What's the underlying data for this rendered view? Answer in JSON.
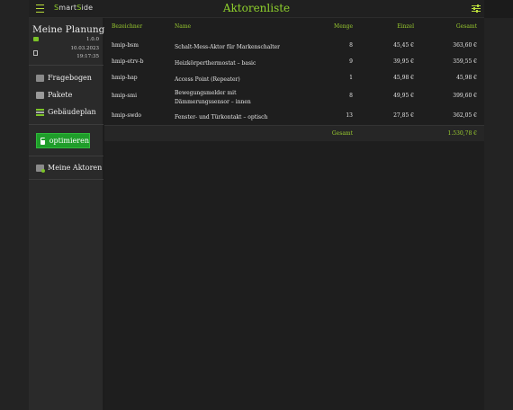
{
  "app": {
    "brand_prefix": "S",
    "brand_mid": "mart",
    "brand_accent": "S",
    "brand_suffix": "ide",
    "page_title": "Aktorenliste"
  },
  "project": {
    "title": "Meine Planung",
    "version": "1.0.0",
    "date": "10.03.2023",
    "time": "19:17:35"
  },
  "nav": {
    "fragebogen": "Fragebogen",
    "pakete": "Pakete",
    "gebaeudeplan": "Gebäudeplan",
    "optimieren": "optimieren",
    "meine_aktoren": "Meine Aktoren"
  },
  "table": {
    "headers": {
      "bezeichner": "Bezeichner",
      "name": "Name",
      "menge": "Menge",
      "einzel": "Einzel",
      "gesamt": "Gesamt"
    },
    "rows": [
      {
        "bezeichner": "hmip-bsm",
        "name": "Schalt-Mess-Aktor für Markenschalter",
        "name2": "",
        "menge": "8",
        "einzel": "45,45 €",
        "gesamt": "363,60 €"
      },
      {
        "bezeichner": "hmip-etrv-b",
        "name": "Heizkörperthermostat – basic",
        "name2": "",
        "menge": "9",
        "einzel": "39,95 €",
        "gesamt": "359,55 €"
      },
      {
        "bezeichner": "hmip-hap",
        "name": "Access Point (Repeater)",
        "name2": "",
        "menge": "1",
        "einzel": "45,98 €",
        "gesamt": "45,98 €"
      },
      {
        "bezeichner": "hmip-smi",
        "name": "Bewegungsmelder mit",
        "name2": "Dämmerungssensor – innen",
        "menge": "8",
        "einzel": "49,95 €",
        "gesamt": "399,60 €"
      },
      {
        "bezeichner": "hmip-swdo",
        "name": "Fenster- und Türkontakt – optisch",
        "name2": "",
        "menge": "13",
        "einzel": "27,85 €",
        "gesamt": "362,05 €"
      }
    ],
    "footer": {
      "label": "Gesamt",
      "total": "1.530,78 €"
    }
  },
  "colors": {
    "accent_green": "#8fd12c",
    "button_green": "#1f9d2a"
  },
  "icons": [
    "menu-icon",
    "settings-icon",
    "tag-icon",
    "save-icon",
    "questionnaire-icon",
    "package-icon",
    "floorplan-icon",
    "calculator-icon",
    "actuators-icon"
  ]
}
